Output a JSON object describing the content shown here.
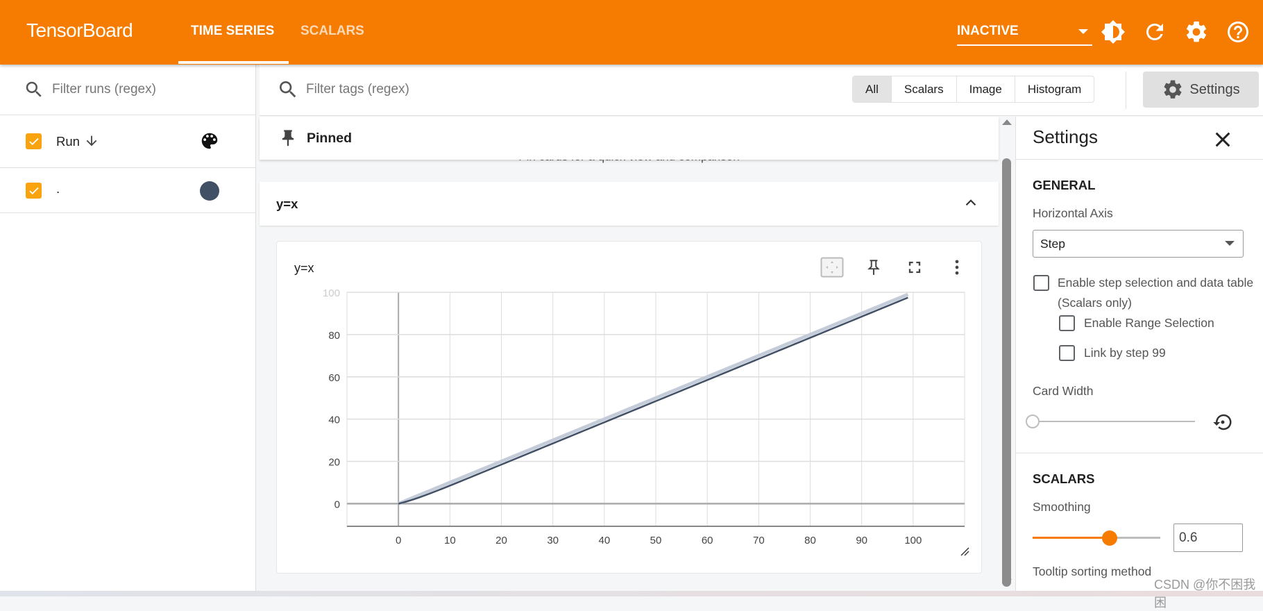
{
  "header": {
    "brand": "TensorBoard",
    "tabs": [
      {
        "label": "TIME SERIES",
        "active": true
      },
      {
        "label": "SCALARS",
        "active": false
      }
    ],
    "status_select": "INACTIVE",
    "icons": [
      "brightness-icon",
      "refresh-icon",
      "gear-icon",
      "help-icon"
    ],
    "color": "#f57c00"
  },
  "sidebar": {
    "filter_placeholder": "Filter runs (regex)",
    "header_label": "Run",
    "sort_icon": "arrow-down-icon",
    "runs": [
      {
        "label": ".",
        "checked": true,
        "color": "#425066"
      }
    ]
  },
  "toolbar": {
    "filter_placeholder": "Filter tags (regex)",
    "chips": [
      {
        "label": "All",
        "active": true
      },
      {
        "label": "Scalars"
      },
      {
        "label": "Image"
      },
      {
        "label": "Histogram"
      }
    ],
    "settings_label": "Settings"
  },
  "main": {
    "pinned_label": "Pinned",
    "pinned_hint": "Pin cards for a quick view and comparison",
    "group_title": "y=x",
    "card_title": "y=x"
  },
  "settings": {
    "title": "Settings",
    "general_heading": "GENERAL",
    "horizontal_axis_label": "Horizontal Axis",
    "horizontal_axis_value": "Step",
    "step_selection_label": "Enable step selection and data table",
    "step_selection_sub": "(Scalars only)",
    "range_selection_label": "Enable Range Selection",
    "link_by_step_label": "Link by step 99",
    "card_width_label": "Card Width",
    "card_width_level": 0,
    "scalars_heading": "SCALARS",
    "smoothing_label": "Smoothing",
    "smoothing_value": "0.6",
    "smoothing_max": 0.999,
    "tooltip_sort_label": "Tooltip sorting method"
  },
  "watermark": "CSDN @你不困我困",
  "chart_data": {
    "type": "line",
    "title": "y=x",
    "xlabel": "",
    "ylabel": "",
    "xlim": [
      -10,
      110
    ],
    "ylim": [
      -10.7,
      100
    ],
    "x_ticks": [
      0,
      10,
      20,
      30,
      40,
      50,
      60,
      70,
      80,
      90,
      100
    ],
    "y_ticks": [
      0,
      20,
      40,
      60,
      80,
      100
    ],
    "grid": true,
    "smoothing": 0.6,
    "series": [
      {
        "color": "#425066",
        "x": [
          0,
          1,
          2,
          3,
          4,
          5,
          6,
          7,
          8,
          9,
          10,
          11,
          12,
          13,
          14,
          15,
          16,
          17,
          18,
          19,
          20,
          21,
          22,
          23,
          24,
          25,
          26,
          27,
          28,
          29,
          30,
          31,
          32,
          33,
          34,
          35,
          36,
          37,
          38,
          39,
          40,
          41,
          42,
          43,
          44,
          45,
          46,
          47,
          48,
          49,
          50,
          51,
          52,
          53,
          54,
          55,
          56,
          57,
          58,
          59,
          60,
          61,
          62,
          63,
          64,
          65,
          66,
          67,
          68,
          69,
          70,
          71,
          72,
          73,
          74,
          75,
          76,
          77,
          78,
          79,
          80,
          81,
          82,
          83,
          84,
          85,
          86,
          87,
          88,
          89,
          90,
          91,
          92,
          93,
          94,
          95,
          96,
          97,
          98,
          99
        ],
        "y": [
          0,
          1,
          2,
          3,
          4,
          5,
          6,
          7,
          8,
          9,
          10,
          11,
          12,
          13,
          14,
          15,
          16,
          17,
          18,
          19,
          20,
          21,
          22,
          23,
          24,
          25,
          26,
          27,
          28,
          29,
          30,
          31,
          32,
          33,
          34,
          35,
          36,
          37,
          38,
          39,
          40,
          41,
          42,
          43,
          44,
          45,
          46,
          47,
          48,
          49,
          50,
          51,
          52,
          53,
          54,
          55,
          56,
          57,
          58,
          59,
          60,
          61,
          62,
          63,
          64,
          65,
          66,
          67,
          68,
          69,
          70,
          71,
          72,
          73,
          74,
          75,
          76,
          77,
          78,
          79,
          80,
          81,
          82,
          83,
          84,
          85,
          86,
          87,
          88,
          89,
          90,
          91,
          92,
          93,
          94,
          95,
          96,
          97,
          98,
          99
        ]
      }
    ]
  }
}
